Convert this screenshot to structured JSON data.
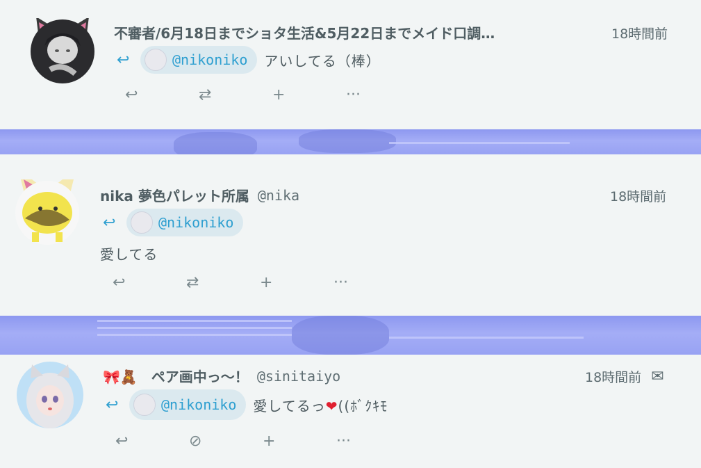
{
  "notes": [
    {
      "name": "不審者/6月18日までショタ生活&5月22日までメイド口調…",
      "handle": "",
      "time": "18時間前",
      "reply_icon": "reply-arrow-icon",
      "mention": "@nikoniko",
      "text": "アいしてる（棒）",
      "actions": [
        "reply-icon",
        "renote-icon",
        "plus-icon",
        "more-icon"
      ]
    },
    {
      "name": "nika 夢色パレット所属",
      "handle": "@nika",
      "time": "18時間前",
      "mention": "@nikoniko",
      "text": "愛してる",
      "actions": [
        "reply-icon",
        "renote-icon",
        "plus-icon",
        "more-icon"
      ]
    },
    {
      "name": "🎀🧸　ペア画中っ～！",
      "handle": "@sinitaiyo",
      "time": "18時間前",
      "mention": "@nikoniko",
      "text": "愛してるっ",
      "text_heart": "❤",
      "text_suffix": "((ﾎﾞｸｷﾓ",
      "actions": [
        "reply-icon",
        "blocked-icon",
        "plus-icon",
        "more-icon"
      ]
    }
  ],
  "icons": {
    "reply": "↩",
    "renote": "⇄",
    "plus": "+",
    "more": "···",
    "blocked": "⊘",
    "mail": "✉"
  }
}
